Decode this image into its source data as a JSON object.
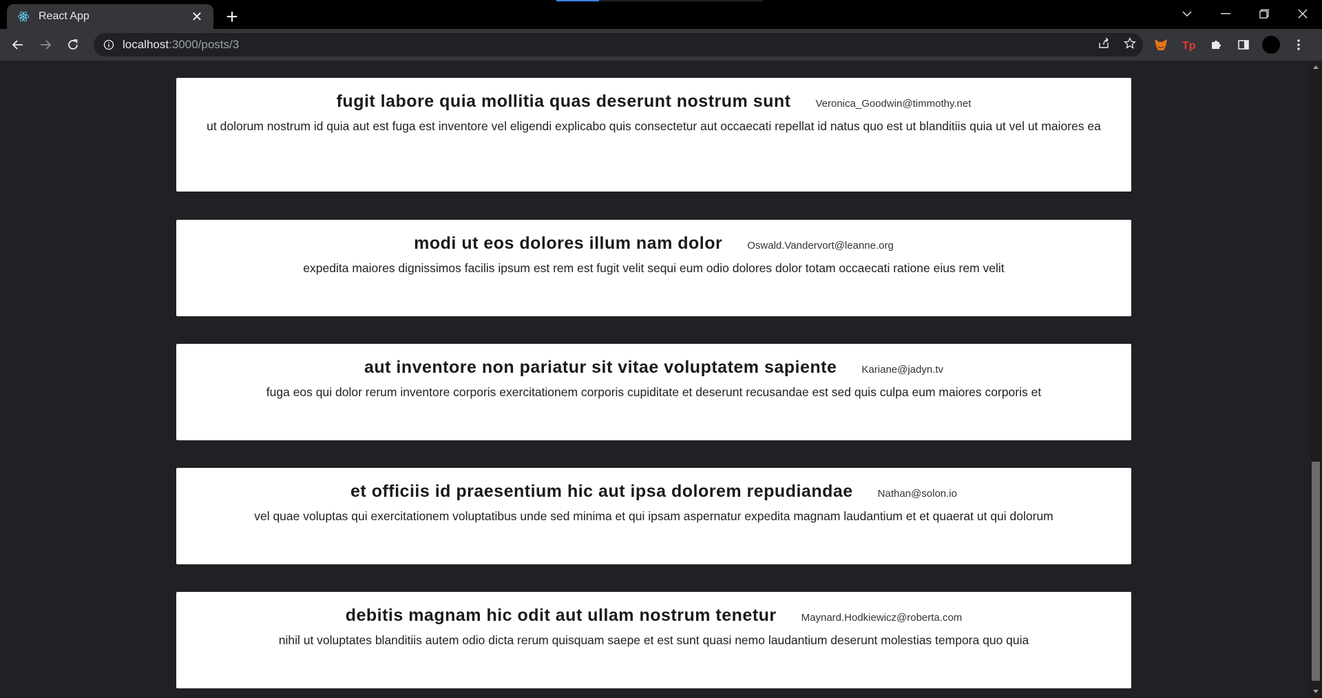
{
  "browser": {
    "tab_title": "React App",
    "url_host": "localhost",
    "url_path": ":3000/posts/3"
  },
  "colors": {
    "accent": "#3b82f6",
    "page_background": "#202124",
    "card_background": "#ffffff"
  },
  "posts": [
    {
      "title": "fugit labore quia mollitia quas deserunt nostrum sunt",
      "email": "Veronica_Goodwin@timmothy.net",
      "body": "ut dolorum nostrum id quia aut est fuga est inventore vel eligendi explicabo quis consectetur aut occaecati repellat id natus quo est ut blanditiis quia ut vel ut maiores ea"
    },
    {
      "title": "modi ut eos dolores illum nam dolor",
      "email": "Oswald.Vandervort@leanne.org",
      "body": "expedita maiores dignissimos facilis ipsum est rem est fugit velit sequi eum odio dolores dolor totam occaecati ratione eius rem velit"
    },
    {
      "title": "aut inventore non pariatur sit vitae voluptatem sapiente",
      "email": "Kariane@jadyn.tv",
      "body": "fuga eos qui dolor rerum inventore corporis exercitationem corporis cupiditate et deserunt recusandae est sed quis culpa eum maiores corporis et"
    },
    {
      "title": "et officiis id praesentium hic aut ipsa dolorem repudiandae",
      "email": "Nathan@solon.io",
      "body": "vel quae voluptas qui exercitationem voluptatibus unde sed minima et qui ipsam aspernatur expedita magnam laudantium et et quaerat ut qui dolorum"
    },
    {
      "title": "debitis magnam hic odit aut ullam nostrum tenetur",
      "email": "Maynard.Hodkiewicz@roberta.com",
      "body": "nihil ut voluptates blanditiis autem odio dicta rerum quisquam saepe et est sunt quasi nemo laudantium deserunt molestias tempora quo quia"
    }
  ]
}
